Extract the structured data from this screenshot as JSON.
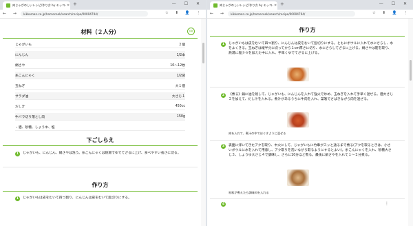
{
  "tab": {
    "title": "肉じゃがのしいレシピ/作り方 by キッコーマン",
    "close": "×",
    "new": "+"
  },
  "window_controls": "— ☐ ✕",
  "nav_icons": "← → ↻",
  "url": "kikkoman.co.jp/homecook/search/recipe/00004794/",
  "addr_icons": "☆ ⬇ 👤 ⋮",
  "left": {
    "badge": "印刷",
    "ingredients_title": "材料（２人分）",
    "ingredients": [
      {
        "name": "じゃがいも",
        "amount": "２個"
      },
      {
        "name": "にんじん",
        "amount": "1/2本"
      },
      {
        "name": "絹さや",
        "amount": "10～12枚"
      },
      {
        "name": "糸こんにゃく",
        "amount": "1/2袋"
      },
      {
        "name": "玉ねぎ",
        "amount": "大１個"
      },
      {
        "name": "サラダ油",
        "amount": "大さじ１"
      },
      {
        "name": "だし汁",
        "amount": "450cc"
      },
      {
        "name": "牛バラ切り落とし肉",
        "amount": "150g"
      },
      {
        "name": "・酒、砂糖、しょうゆ、塩",
        "amount": ""
      }
    ],
    "prep_title": "下ごしらえ",
    "prep_step_no": "1",
    "prep_step": "じゃがいも、にんじん、絹さやは洗う。糸こんにゃくは熱湯でゆでてざるに上げ、食べやすい長さに切る。",
    "method_title": "作り方",
    "method_peek": "じゃがいもは皮をむいて四つ割り、にんじんは皮をむいて乱切りにする。"
  },
  "right": {
    "method_title": "作り方",
    "steps": [
      {
        "no": "1",
        "text": "じゃがいもは皮をむいて四つ割り、にんじんは皮をむいて乱切りにする。ともにボウルに入れて水にさらし、水をよくきる。玉ねぎは縦半分に切ってから１cm厚さに切り、水にさらしてざるに上げる。絹さやは筋を取り、熱湯に塩少々を加えた中に入れ、手早くゆでてざるに上げる。",
        "caption": ""
      },
      {
        "no": "2",
        "text": "《煮る》鍋に油を熱して、じゃがいも、にんじんを入れて強火で炒め、玉ねぎを入れて手早く混ぜる。酒大さじ２を加えて、だし汁を入れる。煮汁があるうちに牛肉を入れ、菜箸でさばきながら肉を混ぜる。",
        "caption": "肉を入れて、煮汁の中でほぐすように混ぜる"
      },
      {
        "no": "3",
        "text": "表面に浮いてきたアクを取り、中火にして、じゃがいもに竹串がスッと通るまで煮る(アクを取るときは、小さいボウルに水を入れて用意し、アク取りを洗いながら取るようにするとよい)。糸こんにゃくを入れ、砂糖大さじ３、しょうゆ大さじ４で調味し、さらに10分ほど煮る。最後に絹さやを入れて１～２分煮る。",
        "caption": "材料が煮えたら調味料を入れる"
      },
      {
        "no": "4",
        "text": "",
        "caption": ""
      }
    ],
    "more": "⋮"
  }
}
